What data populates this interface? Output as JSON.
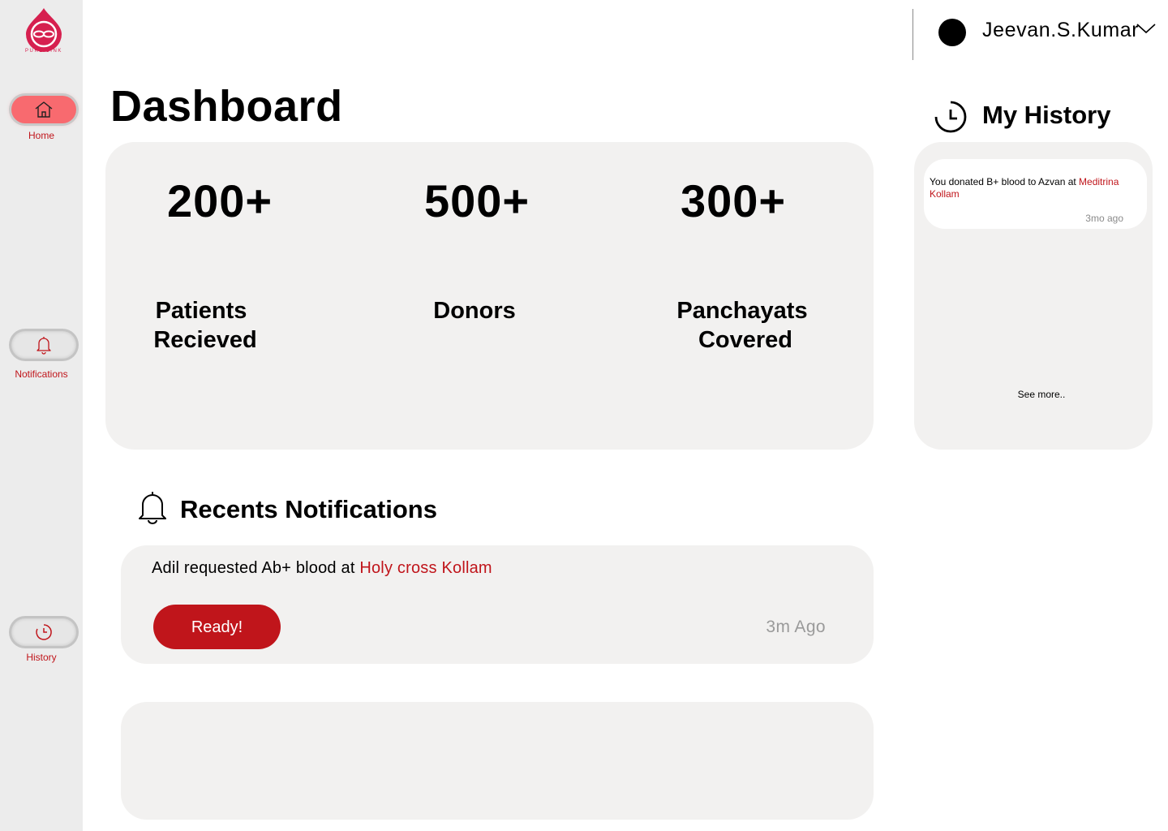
{
  "app": {
    "logo_text": "PURE LINK"
  },
  "sidebar": {
    "items": [
      {
        "label": "Home",
        "icon": "home-icon",
        "active": true
      },
      {
        "label": "Notifications",
        "icon": "bell-icon",
        "active": false
      },
      {
        "label": "History",
        "icon": "clock-icon",
        "active": false
      }
    ]
  },
  "header": {
    "user_name": "Jeevan.S.Kumar"
  },
  "page": {
    "title": "Dashboard"
  },
  "stats": [
    {
      "value": "200+",
      "label_line1": "Patients",
      "label_line2": "Recieved"
    },
    {
      "value": "500+",
      "label_line1": "Donors",
      "label_line2": ""
    },
    {
      "value": "300+",
      "label_line1": "Panchayats",
      "label_line2": "Covered"
    }
  ],
  "history": {
    "title": "My History",
    "items": [
      {
        "text_prefix": "You donated B+ blood to Azvan at ",
        "place": "Meditrina Kollam",
        "time": "3mo ago"
      }
    ],
    "see_more": "See more.."
  },
  "notifications": {
    "title": "Recents Notifications",
    "items": [
      {
        "text_prefix": "Adil requested Ab+ blood at ",
        "place": "Holy cross Kollam",
        "action_label": "Ready!",
        "time": "3m Ago"
      }
    ]
  },
  "colors": {
    "accent": "#c0151b",
    "active_nav": "#f86a6f",
    "card_bg": "#f2f1f0",
    "sidebar_bg": "#ececec"
  }
}
